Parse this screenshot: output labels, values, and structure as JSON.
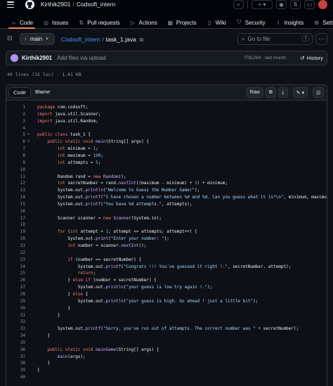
{
  "header": {
    "owner": "Kirthik2901",
    "repo": "Codsoft_intern",
    "separator": "/",
    "plus_label": "+ ▾"
  },
  "repo_nav": [
    {
      "label": "Code",
      "icon": "code-icon",
      "active": true
    },
    {
      "label": "Issues",
      "icon": "issues-icon"
    },
    {
      "label": "Pull requests",
      "icon": "pull-request-icon"
    },
    {
      "label": "Actions",
      "icon": "actions-icon"
    },
    {
      "label": "Projects",
      "icon": "projects-icon"
    },
    {
      "label": "Wiki",
      "icon": "wiki-icon"
    },
    {
      "label": "Security",
      "icon": "shield-icon"
    },
    {
      "label": "Insights",
      "icon": "graph-icon"
    },
    {
      "label": "Settings",
      "icon": "gear-icon"
    }
  ],
  "file_header": {
    "branch": "main",
    "repo_link": "Codsoft_intern",
    "separator": "/",
    "file_name": "task_1.java",
    "go_to_file_placeholder": "Go to file",
    "go_to_file_key": "t"
  },
  "commit": {
    "author": "Kirthik2901",
    "message": "Add files via upload",
    "hash": "f78c264",
    "dot": "·",
    "time": "last month",
    "history_label": "History"
  },
  "file_info": "40 lines (32 loc) · 1.41 KB",
  "code_toolbar": {
    "tab_code": "Code",
    "tab_blame": "Blame",
    "raw_label": "Raw"
  },
  "code_lines": [
    {
      "n": "1",
      "t": [
        [
          "kw",
          "package"
        ],
        [
          "ty",
          " com.codsoft;"
        ]
      ]
    },
    {
      "n": "2",
      "t": [
        [
          "kw",
          "import"
        ],
        [
          "ty",
          " java.util.Scanner;"
        ]
      ]
    },
    {
      "n": "3",
      "t": [
        [
          "kw",
          "import"
        ],
        [
          "ty",
          " java.util.Random;"
        ]
      ]
    },
    {
      "n": "4",
      "t": []
    },
    {
      "n": "5",
      "f": "˅",
      "t": [
        [
          "kw",
          "public class"
        ],
        [
          "ty",
          " task_1 {"
        ]
      ]
    },
    {
      "n": "6",
      "f": "˅",
      "t": [
        [
          "ty",
          "    "
        ],
        [
          "kw",
          "public static void"
        ],
        [
          "fn",
          " main"
        ],
        [
          "ty",
          "(String[] args) {"
        ]
      ]
    },
    {
      "n": "7",
      "t": [
        [
          "ty",
          "        "
        ],
        [
          "kw",
          "int"
        ],
        [
          "ty",
          " minimum = "
        ],
        [
          "num",
          "1"
        ],
        [
          "ty",
          ";"
        ]
      ]
    },
    {
      "n": "8",
      "t": [
        [
          "ty",
          "        "
        ],
        [
          "kw",
          "int"
        ],
        [
          "ty",
          " maximum = "
        ],
        [
          "num",
          "100"
        ],
        [
          "ty",
          ";"
        ]
      ]
    },
    {
      "n": "9",
      "t": [
        [
          "ty",
          "        "
        ],
        [
          "kw",
          "int"
        ],
        [
          "ty",
          " attempts = "
        ],
        [
          "num",
          "5"
        ],
        [
          "ty",
          ";"
        ]
      ]
    },
    {
      "n": "10",
      "t": []
    },
    {
      "n": "11",
      "t": [
        [
          "ty",
          "        Random rand = "
        ],
        [
          "kw",
          "new"
        ],
        [
          "fn",
          " Random"
        ],
        [
          "ty",
          "();"
        ]
      ]
    },
    {
      "n": "12",
      "t": [
        [
          "ty",
          "        "
        ],
        [
          "kw",
          "int"
        ],
        [
          "ty",
          " secretNumber = rand."
        ],
        [
          "fn",
          "nextInt"
        ],
        [
          "ty",
          "((maximum - minimum) + "
        ],
        [
          "num",
          "1"
        ],
        [
          "ty",
          ") + minimum;"
        ]
      ]
    },
    {
      "n": "13",
      "t": [
        [
          "ty",
          "        System.out."
        ],
        [
          "fn",
          "println"
        ],
        [
          "ty",
          "("
        ],
        [
          "str",
          "\"Welcome to Guess the Number Game!\""
        ],
        [
          "ty",
          ");"
        ]
      ]
    },
    {
      "n": "14",
      "t": [
        [
          "ty",
          "        System.out."
        ],
        [
          "fn",
          "printf"
        ],
        [
          "ty",
          "("
        ],
        [
          "str",
          "\"I have chosen a number between %d and %d. Can you guess what it is?\\n\""
        ],
        [
          "ty",
          ", minimum, maximum);"
        ]
      ]
    },
    {
      "n": "15",
      "t": [
        [
          "ty",
          "        System.out."
        ],
        [
          "fn",
          "printf"
        ],
        [
          "ty",
          "("
        ],
        [
          "str",
          "\"You have %d attempts.\""
        ],
        [
          "ty",
          ", attempts);"
        ]
      ]
    },
    {
      "n": "16",
      "t": []
    },
    {
      "n": "17",
      "t": [
        [
          "ty",
          "        Scanner scanner = "
        ],
        [
          "kw",
          "new"
        ],
        [
          "fn",
          " Scanner"
        ],
        [
          "ty",
          "(System.in);"
        ]
      ]
    },
    {
      "n": "18",
      "t": []
    },
    {
      "n": "19",
      "t": [
        [
          "ty",
          "        "
        ],
        [
          "kw",
          "for"
        ],
        [
          "ty",
          " ("
        ],
        [
          "kw",
          "int"
        ],
        [
          "ty",
          " attempt = "
        ],
        [
          "num",
          "1"
        ],
        [
          "ty",
          "; attempt <= attempts; attempt++) {"
        ]
      ]
    },
    {
      "n": "20",
      "t": [
        [
          "ty",
          "            System.out."
        ],
        [
          "fn",
          "print"
        ],
        [
          "ty",
          "("
        ],
        [
          "str",
          "\"Enter your number: \""
        ],
        [
          "ty",
          ");"
        ]
      ]
    },
    {
      "n": "21",
      "t": [
        [
          "ty",
          "            "
        ],
        [
          "kw",
          "int"
        ],
        [
          "ty",
          " number = scanner."
        ],
        [
          "fn",
          "nextInt"
        ],
        [
          "ty",
          "();"
        ]
      ]
    },
    {
      "n": "22",
      "t": []
    },
    {
      "n": "23",
      "t": [
        [
          "ty",
          "            "
        ],
        [
          "kw",
          "if"
        ],
        [
          "ty",
          " (number == secretNumber) {"
        ]
      ]
    },
    {
      "n": "24",
      "t": [
        [
          "ty",
          "                System.out."
        ],
        [
          "fn",
          "printf"
        ],
        [
          "ty",
          "("
        ],
        [
          "str",
          "\"Congrats !!! You've guessed it right !.\""
        ],
        [
          "ty",
          ", secretNumber, attempt);"
        ]
      ]
    },
    {
      "n": "25",
      "t": [
        [
          "ty",
          "                "
        ],
        [
          "kw",
          "return"
        ],
        [
          "ty",
          ";"
        ]
      ]
    },
    {
      "n": "26",
      "t": [
        [
          "ty",
          "            } "
        ],
        [
          "kw",
          "else if"
        ],
        [
          "ty",
          " (number < secretNumber) {"
        ]
      ]
    },
    {
      "n": "27",
      "t": [
        [
          "ty",
          "                System.out."
        ],
        [
          "fn",
          "println"
        ],
        [
          "ty",
          "("
        ],
        [
          "str",
          "\"your guess is low try again !.\""
        ],
        [
          "ty",
          ");"
        ]
      ]
    },
    {
      "n": "28",
      "t": [
        [
          "ty",
          "            } "
        ],
        [
          "kw",
          "else"
        ],
        [
          "ty",
          " {"
        ]
      ]
    },
    {
      "n": "29",
      "t": [
        [
          "ty",
          "                System.out."
        ],
        [
          "fn",
          "println"
        ],
        [
          "ty",
          "("
        ],
        [
          "str",
          "\"your guess is high. Go ahead ! just a little bit\""
        ],
        [
          "ty",
          ");"
        ]
      ]
    },
    {
      "n": "30",
      "t": [
        [
          "ty",
          "            }"
        ]
      ]
    },
    {
      "n": "31",
      "t": [
        [
          "ty",
          "        }"
        ]
      ]
    },
    {
      "n": "32",
      "t": []
    },
    {
      "n": "33",
      "t": [
        [
          "ty",
          "        System.out."
        ],
        [
          "fn",
          "printf"
        ],
        [
          "ty",
          "("
        ],
        [
          "str",
          "\"Sorry, you've run out of attempts. The correct number was \""
        ],
        [
          "ty",
          " + secretNumber);"
        ]
      ]
    },
    {
      "n": "34",
      "t": [
        [
          "ty",
          "    }"
        ]
      ]
    },
    {
      "n": "35",
      "t": []
    },
    {
      "n": "36",
      "t": [
        [
          "ty",
          "    "
        ],
        [
          "kw",
          "public static void"
        ],
        [
          "fn",
          " mainGame"
        ],
        [
          "ty",
          "(String[] args) {"
        ]
      ]
    },
    {
      "n": "37",
      "t": [
        [
          "ty",
          "        "
        ],
        [
          "fn",
          "main"
        ],
        [
          "ty",
          "(args);"
        ]
      ]
    },
    {
      "n": "38",
      "t": [
        [
          "ty",
          "    }"
        ]
      ]
    },
    {
      "n": "39",
      "t": [
        [
          "ty",
          "}"
        ]
      ]
    },
    {
      "n": "40",
      "t": []
    }
  ]
}
